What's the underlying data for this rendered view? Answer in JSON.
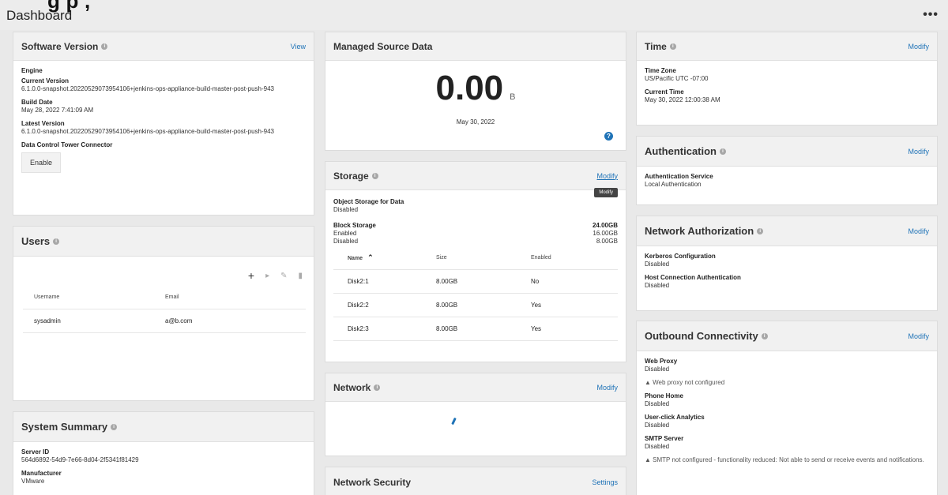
{
  "cutoff_text": "g                                        p             ,",
  "page": {
    "title": "Dashboard",
    "more": "•••"
  },
  "software": {
    "title": "Software Version",
    "view": "View",
    "engine": "Engine",
    "current_label": "Current Version",
    "current_value": "6.1.0.0-snapshot.20220529073954106+jenkins-ops-appliance-build-master-post-push-943",
    "build_label": "Build Date",
    "build_value": "May 28, 2022 7:41:09 AM",
    "latest_label": "Latest Version",
    "latest_value": "6.1.0.0-snapshot.20220529073954106+jenkins-ops-appliance-build-master-post-push-943",
    "dct_label": "Data Control Tower Connector",
    "enable": "Enable"
  },
  "users": {
    "title": "Users",
    "tools": {
      "add": "+",
      "play": "▸",
      "edit": "✎",
      "delete": "▮"
    },
    "columns": [
      "Username",
      "Email"
    ],
    "rows": [
      {
        "username": "sysadmin",
        "email": "a@b.com"
      }
    ]
  },
  "summary": {
    "title": "System Summary",
    "server_label": "Server ID",
    "server_value": "564d6892-54d9-7e66-8d04-2f5341f81429",
    "mfr_label": "Manufacturer",
    "mfr_value": "VMware"
  },
  "managed": {
    "title": "Managed Source Data",
    "value": "0.00",
    "unit": "B",
    "date": "May 30, 2022",
    "help": "?"
  },
  "storage": {
    "title": "Storage",
    "modify": "Modify",
    "tooltip": "Modify",
    "obj_label": "Object Storage for Data",
    "obj_value": "Disabled",
    "block_label": "Block Storage",
    "block_total": "24.00GB",
    "enabled_label": "Enabled",
    "enabled_value": "16.00GB",
    "disabled_label": "Disabled",
    "disabled_value": "8.00GB",
    "columns": [
      "Name",
      "Size",
      "Enabled"
    ],
    "rows": [
      {
        "name": "Disk2:1",
        "size": "8.00GB",
        "enabled": "No"
      },
      {
        "name": "Disk2:2",
        "size": "8.00GB",
        "enabled": "Yes"
      },
      {
        "name": "Disk2:3",
        "size": "8.00GB",
        "enabled": "Yes"
      }
    ]
  },
  "network": {
    "title": "Network",
    "modify": "Modify"
  },
  "netsec": {
    "title": "Network Security",
    "settings": "Settings"
  },
  "time": {
    "title": "Time",
    "modify": "Modify",
    "tz_label": "Time Zone",
    "tz_value": "US/Pacific UTC -07:00",
    "ct_label": "Current Time",
    "ct_value": "May 30, 2022 12:00:38 AM"
  },
  "auth": {
    "title": "Authentication",
    "modify": "Modify",
    "svc_label": "Authentication Service",
    "svc_value": "Local Authentication"
  },
  "netauth": {
    "title": "Network Authorization",
    "modify": "Modify",
    "kerb_label": "Kerberos Configuration",
    "kerb_value": "Disabled",
    "host_label": "Host Connection Authentication",
    "host_value": "Disabled"
  },
  "outbound": {
    "title": "Outbound Connectivity",
    "modify": "Modify",
    "proxy_label": "Web Proxy",
    "proxy_value": "Disabled",
    "proxy_warn": "Web proxy not configured",
    "phone_label": "Phone Home",
    "phone_value": "Disabled",
    "uca_label": "User-click Analytics",
    "uca_value": "Disabled",
    "smtp_label": "SMTP Server",
    "smtp_value": "Disabled",
    "smtp_warn": "SMTP not configured - functionality reduced: Not able to send or receive events and notifications."
  }
}
